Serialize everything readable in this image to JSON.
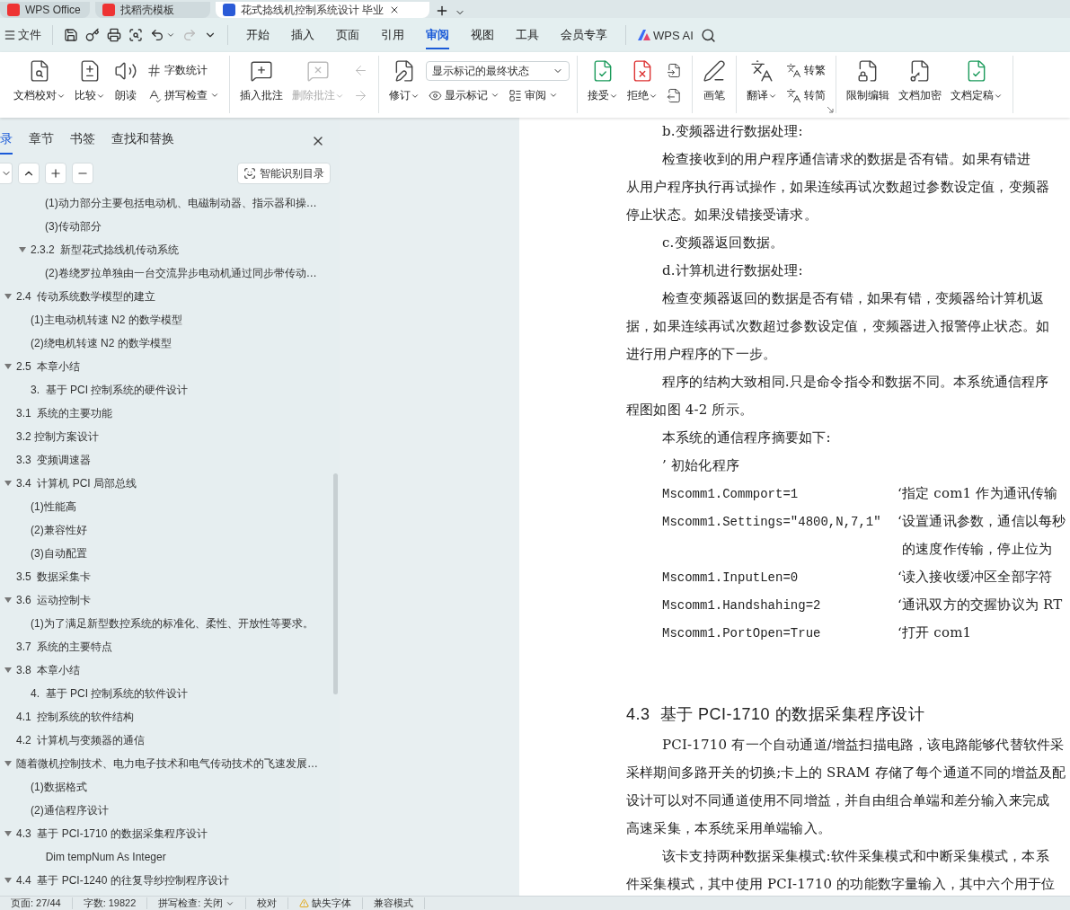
{
  "tab_strip": {
    "tabs": [
      {
        "label": "WPS Office",
        "selected": false
      },
      {
        "label": "找稻壳模板",
        "selected": false
      },
      {
        "label": "花式捻线机控制系统设计 毕业",
        "selected": true
      }
    ]
  },
  "menu_bar": {
    "file_label": "文件",
    "tabs": [
      {
        "label": "开始",
        "selected": false
      },
      {
        "label": "插入",
        "selected": false
      },
      {
        "label": "页面",
        "selected": false
      },
      {
        "label": "引用",
        "selected": false
      },
      {
        "label": "审阅",
        "selected": true
      },
      {
        "label": "视图",
        "selected": false
      },
      {
        "label": "工具",
        "selected": false
      },
      {
        "label": "会员专享",
        "selected": false
      }
    ],
    "ai_label": "WPS AI"
  },
  "ribbon": {
    "groups": [
      {
        "items": [
          {
            "kind": "large",
            "label": "文档校对",
            "dropdown": true,
            "disabled": false
          },
          {
            "kind": "large",
            "label": "比较",
            "dropdown": true,
            "disabled": false
          },
          {
            "kind": "large",
            "label": "朗读",
            "dropdown": false,
            "disabled": false
          },
          {
            "kind": "stack",
            "items": [
              {
                "label": "字数统计",
                "dropdown": false,
                "disabled": false
              },
              {
                "label": "拼写检查",
                "dropdown": true,
                "disabled": false
              }
            ]
          }
        ]
      },
      {
        "items": [
          {
            "kind": "large",
            "label": "插入批注",
            "dropdown": false,
            "disabled": false
          },
          {
            "kind": "large",
            "label": "删除批注",
            "dropdown": true,
            "disabled": true
          },
          {
            "kind": "stack",
            "items": [
              {
                "disabled": true
              },
              {
                "disabled": true
              }
            ]
          }
        ]
      },
      {
        "items": [
          {
            "kind": "large",
            "label": "修订",
            "dropdown": true,
            "disabled": false
          },
          {
            "kind": "select_stack",
            "value": "显示标记的最终状态",
            "items": [
              {
                "label": "显示标记",
                "dropdown": true,
                "disabled": false
              },
              {
                "label": "审阅",
                "dropdown": true,
                "disabled": false
              }
            ]
          }
        ]
      },
      {
        "items": [
          {
            "kind": "large",
            "label": "接受",
            "dropdown": true,
            "disabled": false
          },
          {
            "kind": "large",
            "label": "拒绝",
            "dropdown": true,
            "disabled": false
          },
          {
            "kind": "stack",
            "items": [
              {
                "disabled": false
              },
              {
                "disabled": false
              }
            ]
          }
        ]
      },
      {
        "items": [
          {
            "kind": "large",
            "label": "画笔",
            "dropdown": false,
            "disabled": false
          }
        ]
      },
      {
        "items": [
          {
            "kind": "large",
            "label": "翻译",
            "dropdown": true,
            "disabled": false
          },
          {
            "kind": "stack",
            "items": [
              {
                "label": "转繁",
                "dropdown": false,
                "disabled": false
              },
              {
                "label": "转简",
                "dropdown": false,
                "disabled": false
              }
            ]
          }
        ]
      },
      {
        "items": [
          {
            "kind": "large",
            "label": "限制编辑",
            "dropdown": false,
            "disabled": false
          },
          {
            "kind": "large",
            "label": "文档加密",
            "dropdown": false,
            "disabled": false
          },
          {
            "kind": "large",
            "label": "文档定稿",
            "dropdown": true,
            "disabled": false
          }
        ]
      }
    ]
  },
  "sidebar": {
    "tabs": [
      {
        "label": "录",
        "selected": true
      },
      {
        "label": "章节",
        "selected": false
      },
      {
        "label": "书签",
        "selected": false
      },
      {
        "label": "查找和替换",
        "selected": false
      }
    ],
    "smart_button": "智能识别目录",
    "tree": [
      {
        "children": [
          {
            "children": [
              {
                "label": "(1)动力部分主要包括电动机、电磁制动器、指示器和操…"
              },
              {
                "label": "(3)传动部分"
              }
            ]
          },
          {
            "label": "2.3.2  新型花式捻线机传动系统",
            "expanded": true,
            "children": [
              {
                "label": "(2)卷绕罗拉单独由一台交流异步电动机通过同步带传动…"
              }
            ]
          }
        ]
      },
      {
        "label": "2.4  传动系统数学模型的建立",
        "expanded": true,
        "children": [
          {
            "label": "(1)主电动机转速 N2 的数学模型"
          },
          {
            "label": "(2)绕电机转速 N2 的数学模型"
          }
        ]
      },
      {
        "label": "2.5  本章小结",
        "expanded": true,
        "children": [
          {
            "label": "3.  基于 PCI 控制系统的硬件设计"
          }
        ]
      },
      {
        "label": "3.1  系统的主要功能"
      },
      {
        "label": "3.2 控制方案设计"
      },
      {
        "label": "3.3  变频调速器"
      },
      {
        "label": "3.4  计算机 PCI 局部总线",
        "expanded": true,
        "children": [
          {
            "label": "(1)性能高"
          },
          {
            "label": "(2)兼容性好"
          },
          {
            "label": "(3)自动配置"
          }
        ]
      },
      {
        "label": "3.5  数据采集卡"
      },
      {
        "label": "3.6  运动控制卡",
        "expanded": true,
        "children": [
          {
            "label": "(1)为了满足新型数控系统的标准化、柔性、开放性等要求。"
          }
        ]
      },
      {
        "label": "3.7  系统的主要特点"
      },
      {
        "label": "3.8  本章小结",
        "expanded": true,
        "children": [
          {
            "label": "4.  基于 PCI 控制系统的软件设计"
          }
        ]
      },
      {
        "label": "4.1  控制系统的软件结构"
      },
      {
        "label": "4.2  计算机与变频器的通信"
      },
      {
        "label": "随着微机控制技术、电力电子技术和电气传动技术的飞速发展…",
        "expanded": true,
        "children": [
          {
            "label": "(1)数据格式"
          },
          {
            "label": "(2)通信程序设计"
          }
        ]
      },
      {
        "label": "4.3  基于 PCI-1710 的数据采集程序设计",
        "expanded": true,
        "children": [
          {
            "label": "     Dim tempNum As Integer"
          }
        ]
      },
      {
        "label": "4.4  基于 PCI-1240 的往复导纱控制程序设计",
        "expanded": true
      }
    ]
  },
  "document": {
    "lines": [
      {
        "kind": "indent",
        "text": "b.变频器进行数据处理:"
      },
      {
        "kind": "indent",
        "text": "检查接收到的用户程序通信请求的数据是否有错。如果有错进"
      },
      {
        "kind": "flush",
        "text": "从用户程序执行再试操作，如果连续再试次数超过参数设定值，变频器"
      },
      {
        "kind": "flush",
        "text": "停止状态。如果没错接受请求。"
      },
      {
        "kind": "indent",
        "text": "c.变频器返回数据。"
      },
      {
        "kind": "indent",
        "text": "d.计算机进行数据处理:"
      },
      {
        "kind": "indent",
        "text": "检查变频器返回的数据是否有错，如果有错，变频器给计算机返"
      },
      {
        "kind": "flush",
        "text": "据，如果连续再试次数超过参数设定值，变频器进入报警停止状态。如"
      },
      {
        "kind": "flush",
        "text": "进行用户程序的下一步。"
      },
      {
        "kind": "indent",
        "text": "程序的结构大致相同.只是命令指令和数据不同。本系统通信程序"
      },
      {
        "kind": "flush",
        "text": "程图如图 4-2 所示。"
      },
      {
        "kind": "indent",
        "text": "本系统的通信程序摘要如下:"
      },
      {
        "kind": "indent",
        "text": "’ 初始化程序"
      },
      {
        "kind": "code",
        "code": "Mscomm1.Commport=1",
        "comment": "‘指定 com1 作为通讯传输"
      },
      {
        "kind": "code",
        "code": "Mscomm1.Settings=″4800,N,7,1″",
        "comment": "‘设置通讯参数，通信以每秒"
      },
      {
        "kind": "code",
        "comment": " 的速度作传输，停止位为"
      },
      {
        "kind": "code",
        "code": "Mscomm1.InputLen=0",
        "comment": "‘读入接收缓冲区全部字符"
      },
      {
        "kind": "code",
        "code": "Mscomm1.Handshahing=2",
        "comment": "‘通讯双方的交握协议为 RT"
      },
      {
        "kind": "code",
        "code": "Mscomm1.PortOpen=True",
        "comment": "‘打开 com1"
      },
      {
        "kind": "heading",
        "text": "4.3  基于 PCI-1710 的数据采集程序设计"
      },
      {
        "kind": "indent",
        "text": "PCI-1710 有一个自动通道/增益扫描电路，该电路能够代替软件采"
      },
      {
        "kind": "flush",
        "text": "采样期间多路开关的切换;卡上的 SRAM 存储了每个通道不同的增益及配"
      },
      {
        "kind": "flush",
        "text": "设计可以对不同通道使用不同增益，并自由组合单端和差分输入来完成"
      },
      {
        "kind": "flush",
        "text": "高速采集，本系统采用单端输入。"
      },
      {
        "kind": "indent",
        "text": "该卡支持两种数据采集模式:软件采集模式和中断采集模式，本系"
      },
      {
        "kind": "flush",
        "text": "件采集模式，其中使用 PCI-1710 的功能数字量输入，其中六个用于位"
      }
    ]
  },
  "status_bar": {
    "items": [
      {
        "kind": "text",
        "label": "页面: 27/44"
      },
      {
        "kind": "text",
        "label": "字数: 19822"
      },
      {
        "kind": "dropdown",
        "label": "拼写检查: 关闭"
      },
      {
        "kind": "text",
        "label": "校对"
      },
      {
        "kind": "warning",
        "label": "缺失字体"
      },
      {
        "kind": "text",
        "label": "兼容模式"
      }
    ]
  }
}
